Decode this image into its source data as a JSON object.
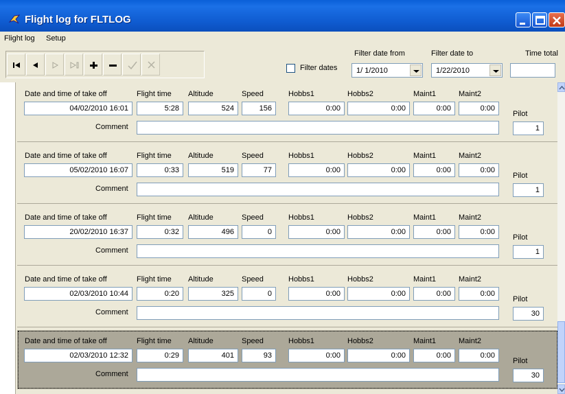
{
  "window": {
    "title": "Flight log for FLTLOG"
  },
  "menu": [
    "Flight log",
    "Setup"
  ],
  "toolbar": {
    "filter_dates_label": "Filter dates",
    "filter_from_label": "Filter date from",
    "filter_from_value": "1/ 1/2010",
    "filter_to_label": "Filter date to",
    "filter_to_value": "1/22/2010",
    "time_total_label": "Time total",
    "time_total_value": ""
  },
  "labels": {
    "takeoff": "Date and time of take off",
    "flight_time": "Flight time",
    "altitude": "Altitude",
    "speed": "Speed",
    "hobbs1": "Hobbs1",
    "hobbs2": "Hobbs2",
    "maint1": "Maint1",
    "maint2": "Maint2",
    "pilot": "Pilot",
    "comment": "Comment"
  },
  "records": [
    {
      "takeoff": "04/02/2010 16:01",
      "flight_time": "5:28",
      "altitude": "524",
      "speed": "156",
      "hobbs1": "0:00",
      "hobbs2": "0:00",
      "maint1": "0:00",
      "maint2": "0:00",
      "pilot": "1",
      "comment": ""
    },
    {
      "takeoff": "05/02/2010 16:07",
      "flight_time": "0:33",
      "altitude": "519",
      "speed": "77",
      "hobbs1": "0:00",
      "hobbs2": "0:00",
      "maint1": "0:00",
      "maint2": "0:00",
      "pilot": "1",
      "comment": ""
    },
    {
      "takeoff": "20/02/2010 16:37",
      "flight_time": "0:32",
      "altitude": "496",
      "speed": "0",
      "hobbs1": "0:00",
      "hobbs2": "0:00",
      "maint1": "0:00",
      "maint2": "0:00",
      "pilot": "1",
      "comment": ""
    },
    {
      "takeoff": "02/03/2010 10:44",
      "flight_time": "0:20",
      "altitude": "325",
      "speed": "0",
      "hobbs1": "0:00",
      "hobbs2": "0:00",
      "maint1": "0:00",
      "maint2": "0:00",
      "pilot": "30",
      "comment": ""
    },
    {
      "takeoff": "02/03/2010 12:32",
      "flight_time": "0:29",
      "altitude": "401",
      "speed": "93",
      "hobbs1": "0:00",
      "hobbs2": "0:00",
      "maint1": "0:00",
      "maint2": "0:00",
      "pilot": "30",
      "comment": ""
    }
  ],
  "selected_record": 4
}
